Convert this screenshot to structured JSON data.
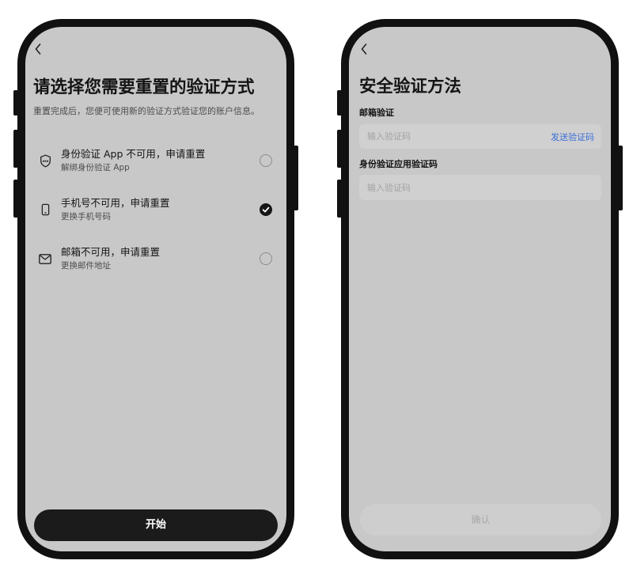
{
  "colors": {
    "frame": "#111111",
    "screen_bg": "#c8c8c8",
    "field_bg": "#d0d0d0",
    "text_primary": "#141414",
    "text_secondary": "#4d4d4d",
    "placeholder": "#a3a3a3",
    "link": "#3a6fd8",
    "primary_button_bg": "#1b1b1b",
    "primary_button_text": "#ffffff",
    "disabled_button_bg": "#cecece",
    "disabled_button_text": "#a8a8a8",
    "radio_outline": "#8c8c8c",
    "radio_checked": "#161616"
  },
  "reset_screen": {
    "back_icon": "chevron-left-icon",
    "title": "请选择您需要重置的验证方式",
    "subtitle": "重置完成后，您便可使用新的验证方式验证您的账户信息。",
    "options": [
      {
        "icon": "shield-dots-icon",
        "label": "身份验证 App 不可用，申请重置",
        "sublabel": "解绑身份验证 App",
        "selected": false
      },
      {
        "icon": "phone-icon",
        "label": "手机号不可用，申请重置",
        "sublabel": "更换手机号码",
        "selected": true
      },
      {
        "icon": "mail-icon",
        "label": "邮箱不可用，申请重置",
        "sublabel": "更换邮件地址",
        "selected": false
      }
    ],
    "start_button": {
      "label": "开始",
      "enabled": true
    }
  },
  "verify_screen": {
    "back_icon": "chevron-left-icon",
    "title": "安全验证方法",
    "email_section": {
      "label": "邮箱验证",
      "placeholder": "输入验证码",
      "value": "",
      "send_code_label": "发送验证码"
    },
    "app_section": {
      "label": "身份验证应用验证码",
      "placeholder": "输入验证码",
      "value": ""
    },
    "confirm_button": {
      "label": "确认",
      "enabled": false
    }
  }
}
